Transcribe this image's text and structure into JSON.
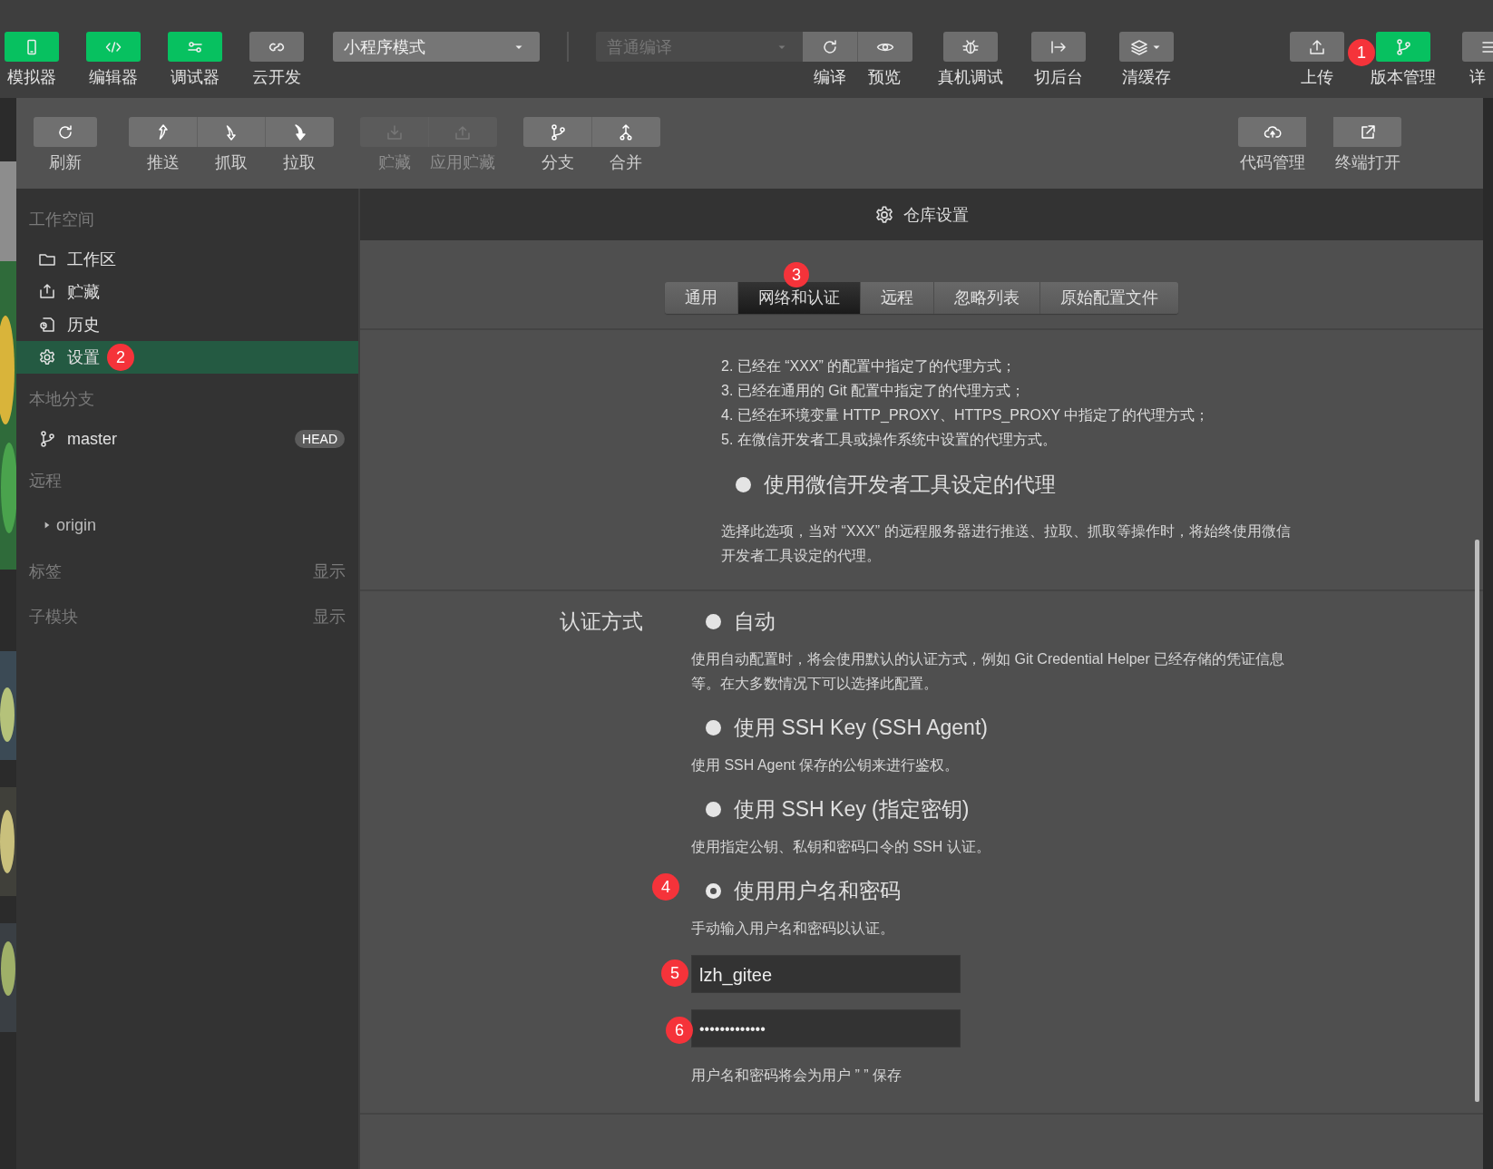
{
  "toolbar": {
    "left_buttons": [
      {
        "label": "模拟器",
        "on": true
      },
      {
        "label": "编辑器",
        "on": true
      },
      {
        "label": "调试器",
        "on": true
      },
      {
        "label": "云开发",
        "on": false
      }
    ],
    "mode_select": {
      "value": "小程序模式"
    },
    "compile_select": {
      "value": "普通编译",
      "disabled": true
    },
    "compile_actions": [
      {
        "label": "编译",
        "on": false
      },
      {
        "label": "预览",
        "on": false
      }
    ],
    "tools": [
      {
        "label": "真机调试",
        "on": false
      },
      {
        "label": "切后台",
        "on": false
      },
      {
        "label": "清缓存",
        "on": false
      }
    ],
    "right_buttons": [
      {
        "label": "上传",
        "on": false
      },
      {
        "label": "版本管理",
        "on": true,
        "badge": "1"
      },
      {
        "label": "详",
        "on": false
      }
    ]
  },
  "git_toolbar": {
    "groups": [
      [
        {
          "label": "刷新",
          "disabled": false
        }
      ],
      [
        {
          "label": "推送",
          "disabled": false
        },
        {
          "label": "抓取",
          "disabled": false
        },
        {
          "label": "拉取",
          "disabled": false
        }
      ],
      [
        {
          "label": "贮藏",
          "disabled": true
        },
        {
          "label": "应用贮藏",
          "disabled": true
        }
      ],
      [
        {
          "label": "分支",
          "disabled": false
        },
        {
          "label": "合并",
          "disabled": false
        }
      ]
    ],
    "right_buttons": [
      {
        "label": "代码管理",
        "disabled": false
      },
      {
        "label": "终端打开",
        "disabled": false
      }
    ]
  },
  "sidebar": {
    "sections": [
      {
        "kind": "nav",
        "title": "工作空间",
        "items": [
          {
            "label": "工作区",
            "selected": false
          },
          {
            "label": "贮藏",
            "selected": false
          },
          {
            "label": "历史",
            "selected": false
          },
          {
            "label": "设置",
            "selected": true,
            "badge": "2"
          }
        ]
      },
      {
        "kind": "branches",
        "title": "本地分支",
        "items": [
          {
            "label": "master",
            "tag": "HEAD"
          }
        ]
      },
      {
        "kind": "remotes",
        "title": "远程",
        "items": [
          {
            "label": "origin",
            "expanded": false
          }
        ]
      },
      {
        "kind": "collapsed",
        "title": "标签",
        "action": "显示"
      },
      {
        "kind": "collapsed",
        "title": "子模块",
        "action": "显示"
      }
    ]
  },
  "settings": {
    "title": "仓库设置",
    "tabs": [
      {
        "label": "通用",
        "selected": false
      },
      {
        "label": "网络和认证",
        "selected": true,
        "badge": "3"
      },
      {
        "label": "远程",
        "selected": false
      },
      {
        "label": "忽略列表",
        "selected": false
      },
      {
        "label": "原始配置文件",
        "selected": false
      }
    ],
    "proxy": {
      "list": [
        "2. 已经在 “XXX” 的配置中指定了的代理方式；",
        "3. 已经在通用的 Git 配置中指定了的代理方式；",
        "4. 已经在环境变量 HTTP_PROXY、HTTPS_PROXY 中指定了的代理方式；",
        "5. 在微信开发者工具或操作系统中设置的代理方式。"
      ],
      "option": {
        "label": "使用微信开发者工具设定的代理",
        "selected": false,
        "description": "选择此选项，当对 “XXX” 的远程服务器进行推送、拉取、抓取等操作时，将始终使用微信开发者工具设定的代理。"
      }
    },
    "auth": {
      "label": "认证方式",
      "options": [
        {
          "label": "自动",
          "selected": false,
          "description": "使用自动配置时，将会使用默认的认证方式，例如 Git Credential Helper 已经存储的凭证信息等。在大多数情况下可以选择此配置。"
        },
        {
          "label": "使用 SSH Key (SSH Agent)",
          "selected": false,
          "description": "使用 SSH Agent 保存的公钥来进行鉴权。"
        },
        {
          "label": "使用 SSH Key (指定密钥)",
          "selected": false,
          "description": "使用指定公钥、私钥和密码口令的 SSH 认证。"
        },
        {
          "label": "使用用户名和密码",
          "selected": true,
          "badge": "4",
          "description": "手动输入用户名和密码以认证。"
        }
      ],
      "username": {
        "value": "lzh_gitee",
        "badge": "5"
      },
      "password": {
        "value": "•••••••••••••",
        "badge": "6"
      },
      "note": "用户名和密码将会为用户 ”  ” 保存"
    }
  }
}
